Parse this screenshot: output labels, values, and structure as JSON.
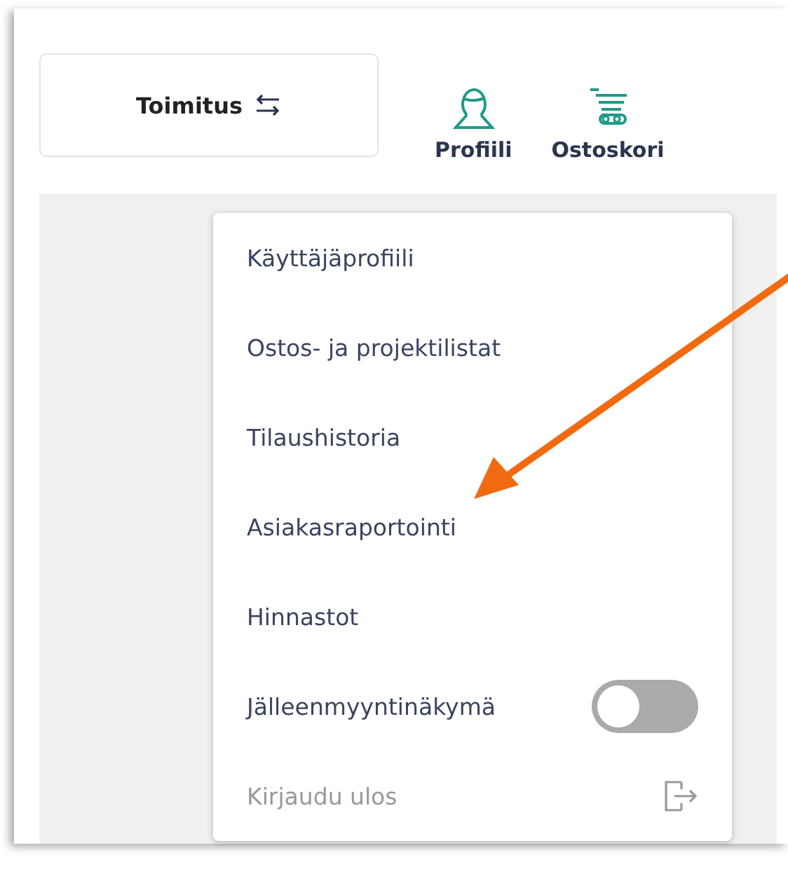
{
  "header": {
    "delivery_button": {
      "label": "Toimitus"
    },
    "nav": [
      {
        "label": "Profiili",
        "kind": "profile"
      },
      {
        "label": "Ostoskori",
        "kind": "cart"
      }
    ]
  },
  "menu": {
    "items": [
      {
        "kind": "link",
        "label": "Käyttäjäprofiili"
      },
      {
        "kind": "link",
        "label": "Ostos- ja projektilistat"
      },
      {
        "kind": "link",
        "label": "Tilaushistoria"
      },
      {
        "kind": "link",
        "label": "Asiakasraportointi"
      },
      {
        "kind": "link",
        "label": "Hinnastot"
      },
      {
        "kind": "toggle",
        "label": "Jälleenmyyntinäkymä",
        "on": false
      },
      {
        "kind": "logout",
        "label": "Kirjaudu ulos"
      }
    ]
  },
  "annotation": {
    "kind": "arrow"
  }
}
